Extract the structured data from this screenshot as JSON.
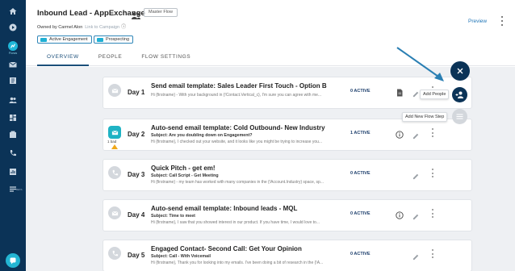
{
  "header": {
    "title": "Inbound Lead - AppExchange",
    "master_chip": "Master Flow",
    "owned_by": "Owned by Carmel Alon",
    "link_campaign": "Link to Campaign",
    "tags": [
      "Active Engagement",
      "Prospecting"
    ],
    "tabs": [
      "OVERVIEW",
      "PEOPLE",
      "FLOW SETTINGS"
    ],
    "preview": "Preview"
  },
  "sidebar": {
    "flows_label": "Flows",
    "beta": "BETA"
  },
  "colors": {
    "sidebar": "#0b3357",
    "accent": "#1fb6d8",
    "active_text": "#1b3d6b",
    "warning": "#f0a81a"
  },
  "steps": [
    {
      "day": "Day 1",
      "title": "Send email template: Sales Leader First Touch - Option B",
      "subject": "",
      "body": "Hi {firstname} - With your background in {!Contact.Vertical_c}, I'm sure you can agree with me...",
      "active": "0 ACTIVE",
      "type_icon": "email-icon",
      "mid_icon": "document-icon"
    },
    {
      "day": "Day 2",
      "title": "Auto-send email template: Cold Outbound- New Industry",
      "subject": "Subject: Are you doubling down on Engagement?",
      "body": "Hi {firstname},   I checked out your website, and it looks like you might be trying to increase you...",
      "active": "1 ACTIVE",
      "type_icon": "auto-email-icon",
      "icon_label": "1 bad",
      "mid_icon": "info-icon"
    },
    {
      "day": "Day 3",
      "title": "Quick Pitch - get em!",
      "subject": "Subject: Call Script - Get Meeting",
      "body": "Hi {firstname} - my team has worked with many companies in the {!Account.Industry} space, sp...",
      "active": "0 ACTIVE",
      "type_icon": "phone-icon"
    },
    {
      "day": "Day 4",
      "title": "Auto-send email template: Inbound leads - MQL",
      "subject": "Subject: Time to meet",
      "body": "Hi {firstname},   I saw that you showed interest in our product. If you have time, I would love to...",
      "active": "0 ACTIVE",
      "type_icon": "email-icon",
      "mid_icon": "info-icon"
    },
    {
      "day": "Day 5",
      "title": "Engaged Contact- Second Call: Get Your Opinion",
      "subject": "Subject: Call - With Voicemail",
      "body": "Hi {firstname}, Thank you for looking into my emails. I've been doing a bit of research in the {!A...",
      "active": "0 ACTIVE",
      "type_icon": "phone-icon"
    }
  ],
  "fab": {
    "add_people": "Add People",
    "add_step": "Add New Flow Step"
  }
}
